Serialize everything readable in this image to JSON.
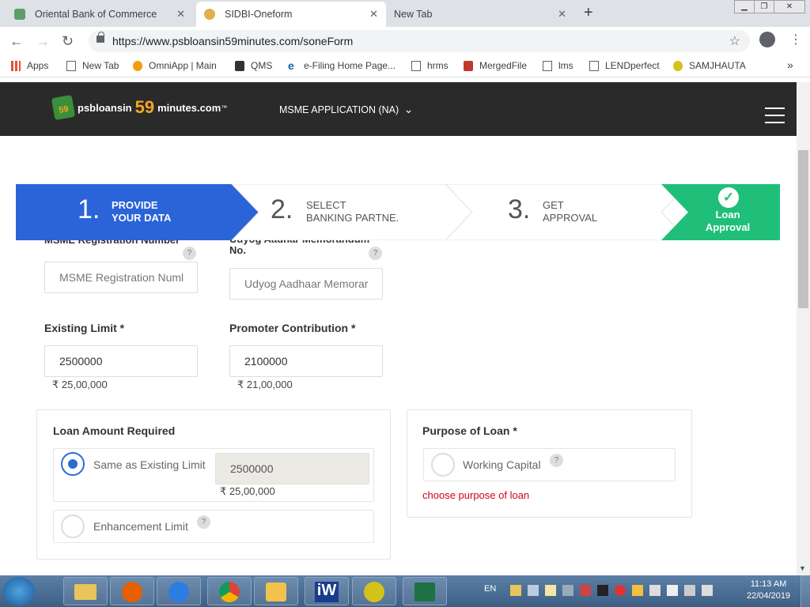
{
  "browser": {
    "tabs": [
      {
        "title": "Oriental Bank of Commerce",
        "active": false
      },
      {
        "title": "SIDBI-Oneform",
        "active": true
      },
      {
        "title": "New Tab",
        "active": false
      }
    ],
    "url": "https://www.psbloansin59minutes.com/soneForm",
    "bookmarks": [
      "Apps",
      "New Tab",
      "OmniApp | Main",
      "QMS",
      "e-Filing Home Page...",
      "hrms",
      "MergedFile",
      "lms",
      "LENDperfect",
      "SAMJHAUTA"
    ],
    "bookmarks_more": "»"
  },
  "site": {
    "logo": {
      "badge": "59",
      "text1": "psbloansin",
      "text2": "59",
      "text3": "minutes.com",
      "tm": "™"
    },
    "app_menu": "MSME APPLICATION (NA)",
    "chevron": "⌄"
  },
  "steps": [
    {
      "num": "1.",
      "line1": "PROVIDE",
      "line2": "YOUR DATA"
    },
    {
      "num": "2.",
      "line1": "SELECT",
      "line2": "BANKING PARTNE."
    },
    {
      "num": "3.",
      "line1": "GET",
      "line2": "APPROVAL"
    },
    {
      "num": "",
      "line1": "Loan",
      "line2": "Approval"
    }
  ],
  "form": {
    "msme_label": "MSME Registration Number",
    "msme_placeholder": "MSME Registration Numl",
    "udyog_label": "Udyog Aadhar Memorandum No.",
    "udyog_placeholder": "Udyog Aadhaar Memorar",
    "existing_label": "Existing Limit *",
    "existing_value": "2500000",
    "existing_words": "₹ 25,00,000",
    "promoter_label": "Promoter Contribution *",
    "promoter_value": "2100000",
    "promoter_words": "₹ 21,00,000",
    "loan_card_title": "Loan Amount Required",
    "same_as_label": "Same as Existing Limit",
    "same_as_value": "2500000",
    "same_as_words": "₹ 25,00,000",
    "enhancement_label": "Enhancement Limit",
    "purpose_title": "Purpose of Loan *",
    "purpose_option": "Working Capital",
    "purpose_error": "choose purpose of loan",
    "help": "?"
  },
  "taskbar": {
    "lang": "EN",
    "time": "11:13 AM",
    "date": "22/04/2019"
  },
  "colors": {
    "step_active": "#2b63d9",
    "step_done": "#1fbf7a",
    "header_bg": "#2a2a2a",
    "accent_orange": "#f5a623",
    "error_red": "#d0021b"
  }
}
